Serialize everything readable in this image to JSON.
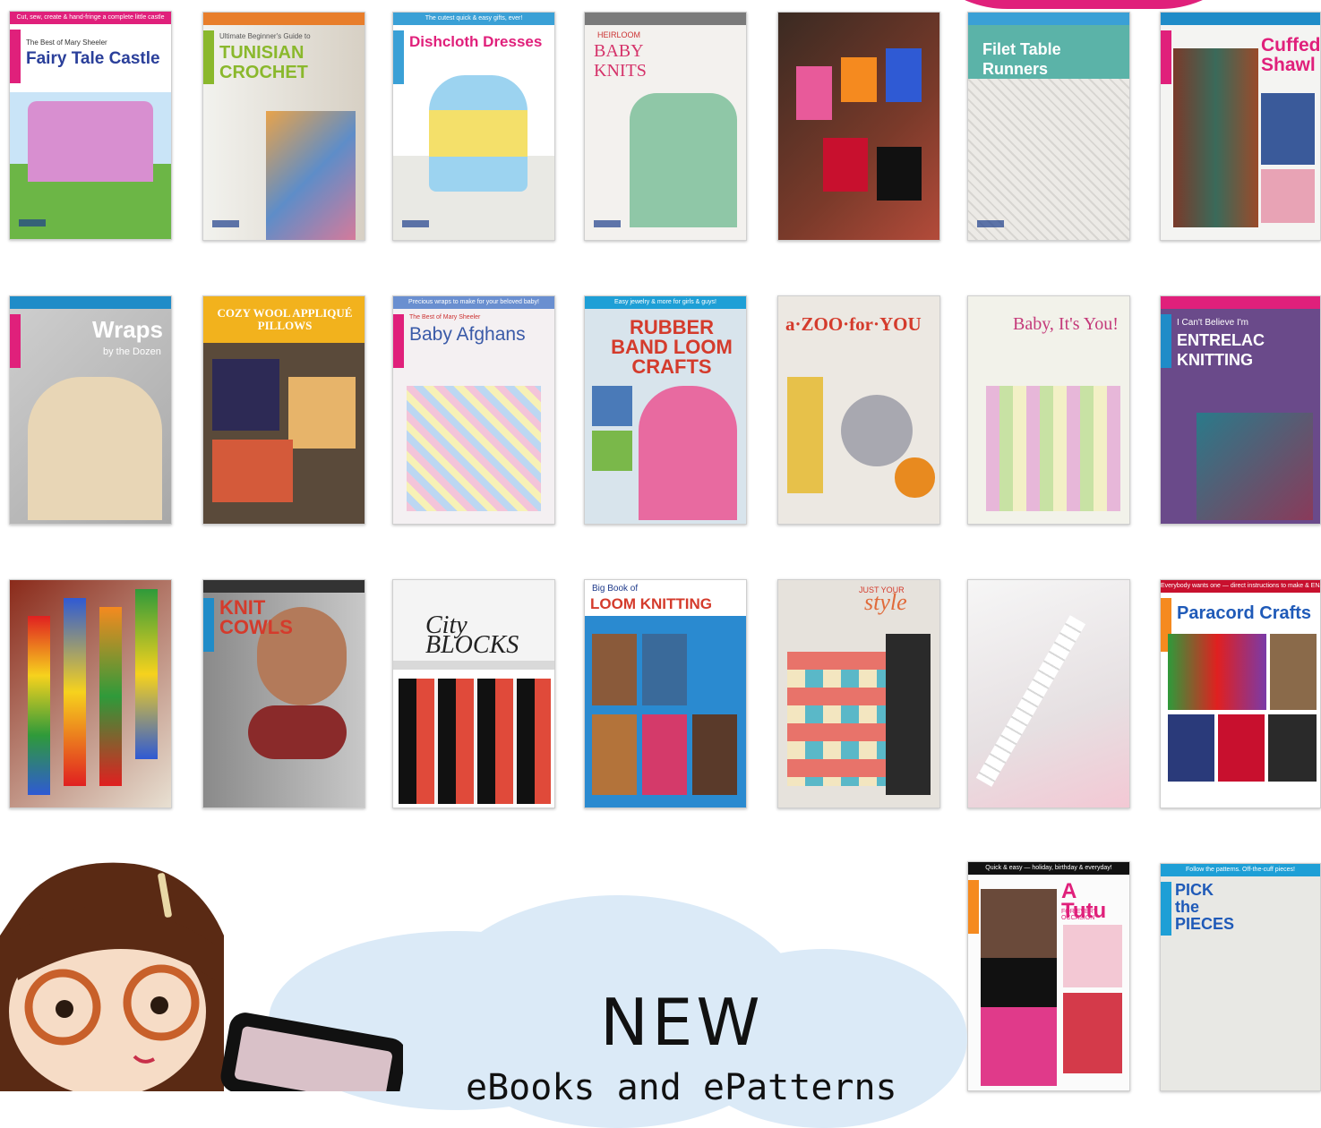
{
  "covers": {
    "c1": {
      "band": "Cut, sew, create & hand-fringe a complete little castle",
      "title": "Fairy Tale Castle",
      "sub": "The Best of Mary Sheeler"
    },
    "c2": {
      "title": "TUNISIAN CROCHET",
      "sub": "Ultimate Beginner's Guide to"
    },
    "c3": {
      "band": "The cutest quick & easy gifts, ever!",
      "title": "Dishcloth Dresses"
    },
    "c4": {
      "title": "BABY KNITS",
      "sub": "HEIRLOOM"
    },
    "c5": {},
    "c6": {
      "title": "Filet Table Runners"
    },
    "c7": {
      "title": "Cuffed Shawl"
    },
    "c8": {
      "title": "Wraps",
      "sub": "by the Dozen"
    },
    "c9": {
      "title": "COZY WOOL APPLIQUÉ PILLOWS"
    },
    "c10": {
      "band": "Precious wraps to make for your beloved baby!",
      "title": "Baby Afghans",
      "sub": "The Best of Mary Sheeler"
    },
    "c11": {
      "band": "Easy jewelry & more for girls & guys!",
      "title": "RUBBER BAND LOOM CRAFTS"
    },
    "c12": {
      "title": "a·ZOO·for·YOU"
    },
    "c13": {
      "title": "Baby, It's You!"
    },
    "c14": {
      "title": "ENTRELAC KNITTING",
      "sub": "I Can't Believe I'm"
    },
    "c15": {},
    "c16": {
      "title": "KNIT COWLS"
    },
    "c17": {
      "title": "City BLOCKS"
    },
    "c18": {
      "title": "LOOM KNITTING",
      "sub": "Big Book of"
    },
    "c19": {
      "title": "style",
      "sub": "JUST YOUR"
    },
    "c20": {},
    "c21": {
      "band": "Everybody wants one — direct instructions to make & ENJOY",
      "title": "Paracord Crafts"
    },
    "c22": {
      "band": "Quick & easy — holiday, birthday & everyday!",
      "title": "A Tutu",
      "sub": "FOR EVERY OCCASION"
    },
    "c23": {
      "band": "Follow the patterns. Off-the-cuff pieces!",
      "title": "PICK the PIECES"
    }
  },
  "promo": {
    "headline": "NEW",
    "subline": "eBooks and ePatterns"
  },
  "colors": {
    "accent": "#e0207b",
    "cloud": "#dbeaf7",
    "brand": "#1e3f8c"
  }
}
